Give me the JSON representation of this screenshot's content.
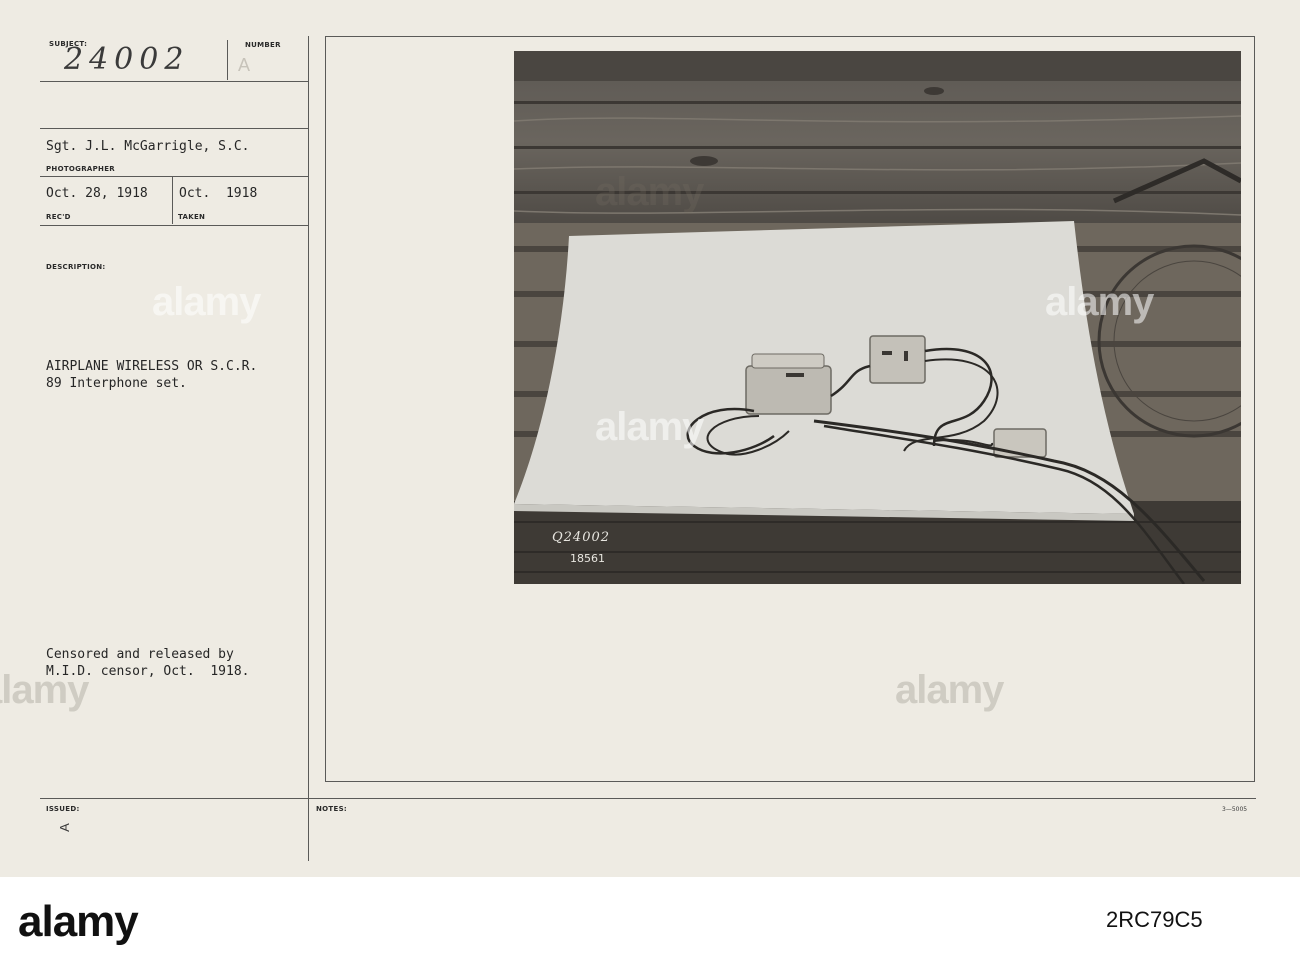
{
  "card": {
    "subject_label": "SUBJECT:",
    "number_label": "NUMBER",
    "subject_number": "24002",
    "subject_letter": "A",
    "photographer": "Sgt. J.L. McGarrigle, S.C.",
    "photographer_label": "PHOTOGRAPHER",
    "recd_date": "Oct. 28, 1918",
    "recd_label": "REC'D",
    "taken_date": "Oct.  1918",
    "taken_label": "TAKEN",
    "description_label": "DESCRIPTION:",
    "description": "AIRPLANE WIRELESS OR S.C.R.\n89 Interphone set.",
    "censor_note": "Censored and released by\nM.I.D. censor, Oct.  1918.",
    "issued_label": "ISSUED:",
    "issued_mark": "A",
    "notes_label": "NOTES:",
    "form_number": "3—5005"
  },
  "photo": {
    "negative_number": "Q24002",
    "secondary_number": "18561"
  },
  "watermark": {
    "text": "alamy",
    "footer_id": "2RC79C5"
  },
  "colors": {
    "card": "#eeebe3",
    "ink": "#262626",
    "rule": "#5a5a58"
  }
}
